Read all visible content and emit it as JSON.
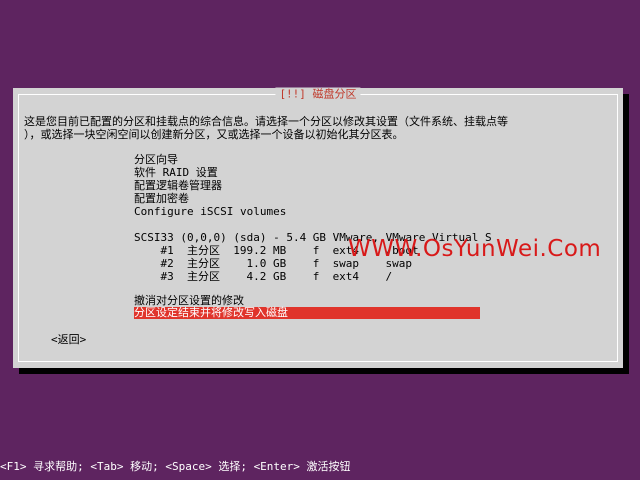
{
  "dialog": {
    "title": "[!!] 磁盘分区",
    "intro_line1": "这是您目前已配置的分区和挂载点的综合信息。请选择一个分区以修改其设置（文件系统、挂载点等",
    "intro_line2": "），或选择一块空闲空间以创建新分区，又或选择一个设备以初始化其分区表。",
    "menu": [
      {
        "label": "分区向导"
      },
      {
        "label": "软件 RAID 设置"
      },
      {
        "label": "配置逻辑卷管理器"
      },
      {
        "label": "配置加密卷"
      },
      {
        "label": "Configure iSCSI volumes"
      }
    ],
    "disk": "SCSI33 (0,0,0) (sda) - 5.4 GB VMware, VMware Virtual S",
    "partitions": [
      {
        "row": "    #1  主分区  199.2 MB    f  ext4    /boot"
      },
      {
        "row": "    #2  主分区    1.0 GB    f  swap    swap"
      },
      {
        "row": "    #3  主分区    4.2 GB    f  ext4    /"
      }
    ],
    "undo": "撤消对分区设置的修改",
    "finish": "分区设定结束并将修改写入磁盘",
    "back": "<返回>"
  },
  "watermark": "WWW.OsYunWei.Com",
  "status_bar": "<F1> 寻求帮助; <Tab> 移动; <Space> 选择; <Enter> 激活按钮",
  "colors": {
    "background": "#5e2460",
    "dialog": "#d3d3d3",
    "highlight": "#e0342b",
    "title": "#c0392b"
  }
}
